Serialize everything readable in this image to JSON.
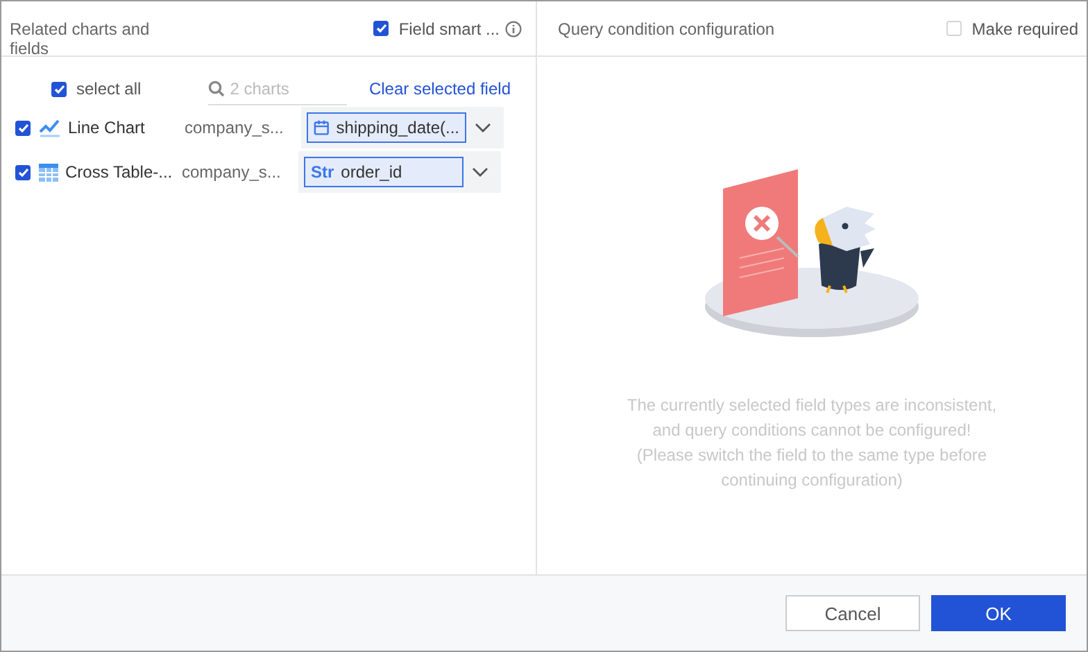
{
  "left_panel": {
    "title": "Related charts and fields",
    "smart_match": {
      "label": "Field smart ...",
      "checked": true
    },
    "select_all": {
      "label": "select all",
      "checked": true
    },
    "search": {
      "placeholder": "2 charts"
    },
    "clear_link": "Clear selected field",
    "charts": [
      {
        "checked": true,
        "kind": "line",
        "name": "Line Chart",
        "dataset": "company_s...",
        "field": {
          "kind": "date",
          "value": "shipping_date(..."
        }
      },
      {
        "checked": true,
        "kind": "table",
        "name": "Cross Table-...",
        "dataset": "company_s...",
        "field": {
          "kind": "string",
          "type_label": "Str",
          "value": "order_id"
        }
      }
    ]
  },
  "right_panel": {
    "title": "Query condition configuration",
    "make_required": {
      "label": "Make required",
      "checked": false
    },
    "message": [
      "The currently selected field types are inconsistent,",
      "and query conditions cannot be configured!",
      "(Please switch the field to the same type before",
      "continuing configuration)"
    ]
  },
  "buttons": [
    {
      "kind": "secondary",
      "label": "Cancel"
    },
    {
      "kind": "primary",
      "label": "OK"
    }
  ]
}
